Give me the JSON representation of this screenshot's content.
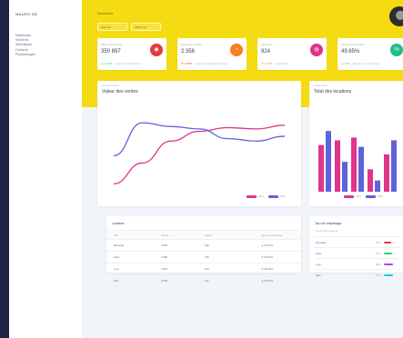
{
  "sidebar": {
    "brand": "MAURO DB",
    "items": [
      {
        "label": "Dashboard"
      },
      {
        "label": "Vendeurs"
      },
      {
        "label": "Statistiques"
      },
      {
        "label": "Contacts"
      },
      {
        "label": "Paramétrages"
      }
    ]
  },
  "header": {
    "title": "Dashboard",
    "chips": [
      {
        "label": "Exporter"
      },
      {
        "label": "Filtrer par"
      }
    ]
  },
  "stats": [
    {
      "label": "Valeur des ventes",
      "value": "350 897",
      "change": "▲ 3.48%",
      "note": "depuis le mois dernier",
      "icon": "chart-icon",
      "glyph": "◉",
      "color": "#e33b3b",
      "change_color": "#2dce89"
    },
    {
      "label": "Nouvelles ventes",
      "value": "2 356",
      "change": "▼ 3.48%",
      "note": "depuis la semaine dernière",
      "icon": "pie-icon",
      "glyph": "◔",
      "color": "#f77f22",
      "change_color": "#e33b3b"
    },
    {
      "label": "Vendeurs",
      "value": "924",
      "change": "▼ 1.10%",
      "note": "depuis hier",
      "icon": "users-icon",
      "glyph": "◍",
      "color": "#e0358a",
      "change_color": "#f77f22"
    },
    {
      "label": "Taux de conversion",
      "value": "49.65%",
      "change": "▲ 12%",
      "note": "depuis le mois dernier",
      "icon": "percent-icon",
      "glyph": "%",
      "color": "#1fbe87",
      "change_color": "#2dce89"
    }
  ],
  "sales_card": {
    "subtitle": "Vue d'ensemble",
    "title": "Valeur des ventes",
    "legend": [
      {
        "name": "2019",
        "color": "#e0358a"
      },
      {
        "name": "2020",
        "color": "#5e63d9"
      }
    ]
  },
  "locations_card": {
    "subtitle": "Performance",
    "title": "Total des locations",
    "legend": [
      {
        "name": "2019",
        "color": "#e0358a"
      },
      {
        "name": "2020",
        "color": "#5e63d9"
      }
    ]
  },
  "chart_data": [
    {
      "type": "line",
      "title": "Valeur des ventes",
      "x": [
        0,
        1,
        2,
        3,
        4,
        5,
        6
      ],
      "series": [
        {
          "name": "2019",
          "color": "#e0358a",
          "values": [
            5,
            22,
            40,
            48,
            51,
            50,
            53
          ]
        },
        {
          "name": "2020",
          "color": "#5e63d9",
          "values": [
            28,
            55,
            52,
            50,
            42,
            40,
            44
          ]
        }
      ],
      "ylim": [
        0,
        70
      ]
    },
    {
      "type": "bar",
      "title": "Total des locations",
      "categories": [
        "1",
        "2",
        "3",
        "4",
        "5"
      ],
      "series": [
        {
          "name": "2019",
          "color": "#e0358a",
          "values": [
            50,
            55,
            58,
            24,
            40
          ]
        },
        {
          "name": "2020",
          "color": "#5e63d9",
          "values": [
            65,
            32,
            48,
            12,
            55
          ]
        }
      ],
      "ylim": [
        0,
        70
      ]
    }
  ],
  "locations_table": {
    "title": "Locations",
    "headers": [
      "Ville",
      "Clients",
      "Ventes",
      "Taux de conversion"
    ],
    "rows": [
      [
        "Marseille",
        "4 569",
        "340",
        "▲ 46.53%"
      ],
      [
        "Paris",
        "3 985",
        "319",
        "▼ 46.53%"
      ],
      [
        "Lyon",
        "3 513",
        "294",
        "▼ 36.49%"
      ],
      [
        "Nice",
        "2 050",
        "147",
        "▲ 50.87%"
      ]
    ]
  },
  "taux_card": {
    "title": "Taux de remplissage",
    "header": "Nombre de vendeurs",
    "rows": [
      {
        "label": "Marseille",
        "pct": "60%",
        "value": 0.6,
        "color": "#e33b3b"
      },
      {
        "label": "Paris",
        "pct": "70%",
        "value": 0.7,
        "color": "#2dce89"
      },
      {
        "label": "Lyon",
        "pct": "80%",
        "value": 0.8,
        "color": "#a64cf0"
      },
      {
        "label": "Nice",
        "pct": "75%",
        "value": 0.75,
        "color": "#11cdef"
      }
    ]
  }
}
